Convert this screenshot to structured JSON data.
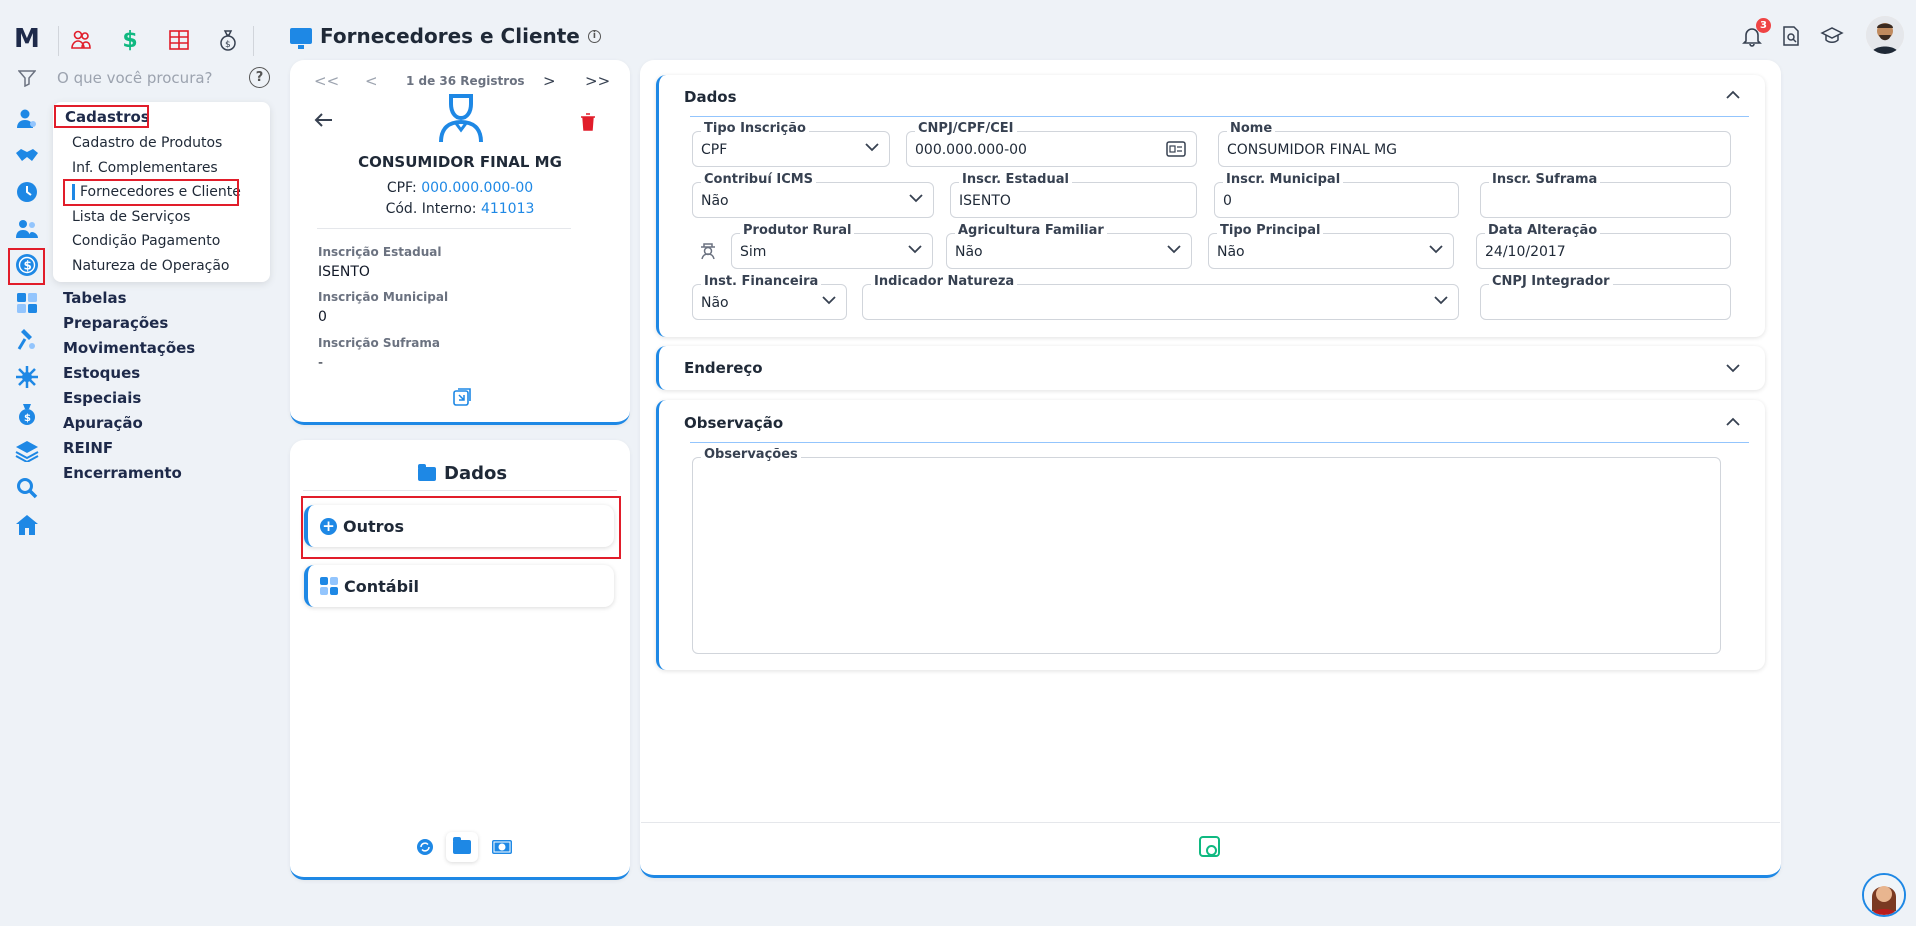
{
  "app": {
    "logo_text": "M",
    "search_placeholder": "O que você procura?",
    "help_symbol": "?"
  },
  "header": {
    "title": "Fornecedores e Cliente",
    "info_symbol": "i",
    "notification_count": "3"
  },
  "sidebar": {
    "cadastros_label": "Cadastros",
    "cadastros_items": [
      "Cadastro de Produtos",
      "Inf. Complementares",
      "Fornecedores e Cliente",
      "Lista de Serviços",
      "Condição Pagamento",
      "Natureza de Operação"
    ],
    "menu_items": [
      "Tabelas",
      "Preparações",
      "Movimentações",
      "Estoques",
      "Especiais",
      "Apuração",
      "REINF",
      "Encerramento"
    ]
  },
  "record": {
    "nav_first": "<<",
    "nav_prev": "<",
    "counter": "1 de 36 Registros",
    "nav_next": ">",
    "nav_last": ">>",
    "name": "CONSUMIDOR FINAL MG",
    "cpf_label": "CPF:",
    "cpf_value": "000.000.000-00",
    "cod_label": "Cód. Interno:",
    "cod_value": "411013",
    "insc_estadual_label": "Inscrição Estadual",
    "insc_estadual_value": "ISENTO",
    "insc_municipal_label": "Inscrição Municipal",
    "insc_municipal_value": "0",
    "insc_suframa_label": "Inscrição Suframa",
    "insc_suframa_value": "-"
  },
  "dados_card": {
    "title": "Dados",
    "outros_label": "Outros",
    "contabil_label": "Contábil"
  },
  "form": {
    "dados_section": "Dados",
    "endereco_section": "Endereço",
    "observacao_section": "Observação",
    "fields": {
      "tipo_inscricao": {
        "label": "Tipo Inscrição",
        "value": "CPF"
      },
      "cnpj_cpf": {
        "label": "CNPJ/CPF/CEI",
        "value": "000.000.000-00"
      },
      "nome": {
        "label": "Nome",
        "value": "CONSUMIDOR FINAL MG"
      },
      "contribui_icms": {
        "label": "Contribuí ICMS",
        "value": "Não"
      },
      "inscr_estadual": {
        "label": "Inscr. Estadual",
        "value": "ISENTO"
      },
      "inscr_municipal": {
        "label": "Inscr. Municipal",
        "value": "0"
      },
      "inscr_suframa": {
        "label": "Inscr. Suframa",
        "value": ""
      },
      "produtor_rural": {
        "label": "Produtor Rural",
        "value": "Sim"
      },
      "agricultura_familiar": {
        "label": "Agricultura Familiar",
        "value": "Não"
      },
      "tipo_principal": {
        "label": "Tipo Principal",
        "value": "Não"
      },
      "data_alteracao": {
        "label": "Data Alteração",
        "value": "24/10/2017"
      },
      "inst_financeira": {
        "label": "Inst. Financeira",
        "value": "Não"
      },
      "indicador_natureza": {
        "label": "Indicador Natureza",
        "value": ""
      },
      "cnpj_integrador": {
        "label": "CNPJ Integrador",
        "value": ""
      },
      "observacoes": {
        "label": "Observações",
        "value": ""
      }
    }
  },
  "colors": {
    "accent": "#1e88e5",
    "highlight_box": "#e11d2a",
    "save_icon": "#10b981",
    "delete_icon": "#e11d2a"
  }
}
